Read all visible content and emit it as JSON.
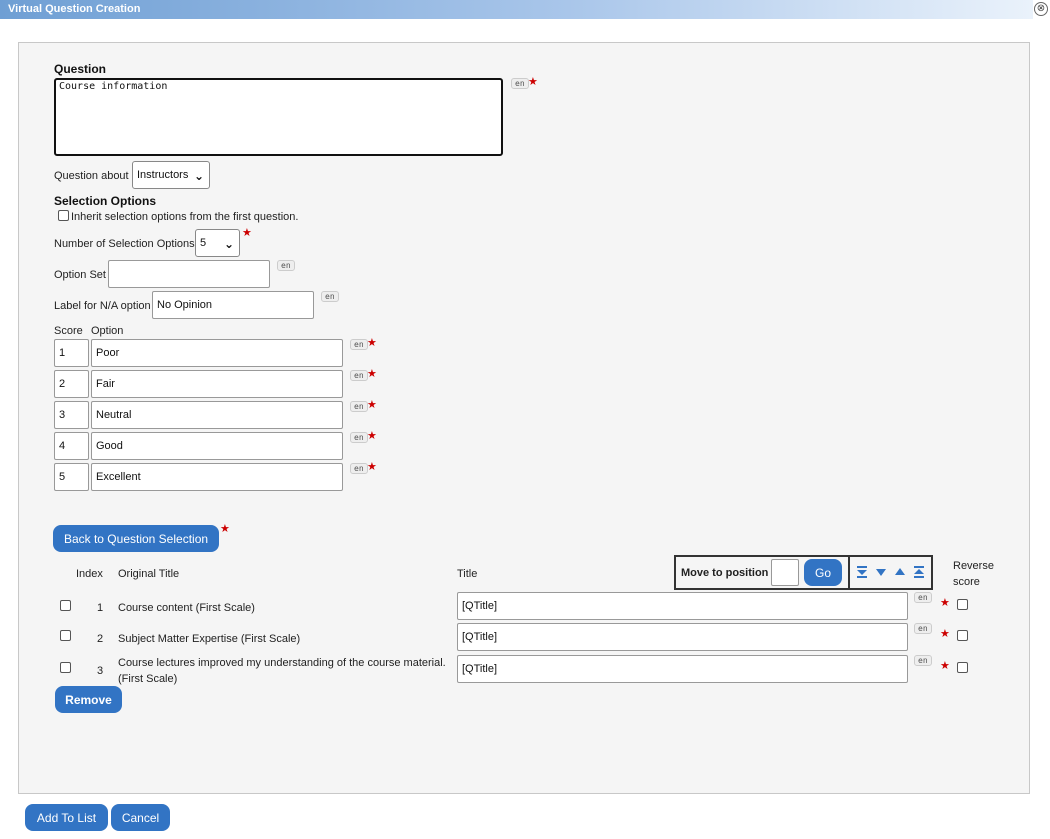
{
  "window": {
    "title": "Virtual Question Creation",
    "close_glyph": "⊗"
  },
  "question": {
    "heading": "Question",
    "text": "Course information",
    "lang": "en"
  },
  "question_about": {
    "label": "Question about",
    "value": "Instructors"
  },
  "selection_options": {
    "heading": "Selection Options",
    "inherit_label": "Inherit selection options from the first question.",
    "inherit_checked": false,
    "num_label": "Number of Selection Options",
    "num_value": "5",
    "option_set_label": "Option Set",
    "option_set_value": "",
    "na_label": "Label for N/A option",
    "na_value": "No Opinion",
    "score_header": "Score",
    "option_header": "Option",
    "options": [
      {
        "score": "1",
        "label": "Poor"
      },
      {
        "score": "2",
        "label": "Fair"
      },
      {
        "score": "3",
        "label": "Neutral"
      },
      {
        "score": "4",
        "label": "Good"
      },
      {
        "score": "5",
        "label": "Excellent"
      }
    ]
  },
  "back_button_label": "Back to Question Selection",
  "table": {
    "index_header": "Index",
    "original_title_header": "Original Title",
    "title_header": "Title",
    "reverse_header_line1": "Reverse",
    "reverse_header_line2": "score",
    "move_label": "Move to position",
    "move_value": "",
    "go_label": "Go",
    "arrow_icons": [
      "move-to-bottom-icon",
      "move-down-icon",
      "move-up-icon",
      "move-to-top-icon"
    ],
    "rows": [
      {
        "index": "1",
        "original_line1": "Course content (First Scale)",
        "original_line2": "",
        "title": "[QTitle]"
      },
      {
        "index": "2",
        "original_line1": "Subject Matter Expertise (First Scale)",
        "original_line2": "",
        "title": "[QTitle]"
      },
      {
        "index": "3",
        "original_line1": "Course lectures improved my understanding of the course material.",
        "original_line2": "(First Scale)",
        "title": "[QTitle]"
      }
    ]
  },
  "remove_label": "Remove",
  "footer": {
    "add_label": "Add To List",
    "cancel_label": "Cancel"
  },
  "colors": {
    "accent": "#3274c4",
    "required": "#cc0000",
    "titlebar_start": "#6f9fd4"
  }
}
